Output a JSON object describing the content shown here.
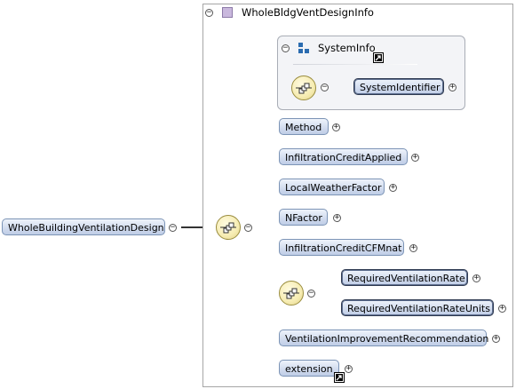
{
  "outer_type": {
    "title": "WholeBldgVentDesignInfo",
    "toggle": "−"
  },
  "system_info": {
    "title": "SystemInfo",
    "toggle": "−"
  },
  "root": {
    "label": "WholeBuildingVentilationDesign",
    "toggle": "−"
  },
  "system_identifier": {
    "label": "SystemIdentifier",
    "toggle": "+"
  },
  "elements": [
    {
      "label": "Method",
      "toggle": "+"
    },
    {
      "label": "InfiltrationCreditApplied",
      "toggle": "+"
    },
    {
      "label": "LocalWeatherFactor",
      "toggle": "+"
    },
    {
      "label": "NFactor",
      "toggle": "+"
    },
    {
      "label": "InfiltrationCreditCFMnat",
      "toggle": "+"
    }
  ],
  "choice_children": [
    {
      "label": "RequiredVentilationRate",
      "toggle": "+"
    },
    {
      "label": "RequiredVentilationRateUnits",
      "toggle": "+"
    }
  ],
  "tail_elements": [
    {
      "label": "VentilationImprovementRecommendation",
      "toggle": "+"
    },
    {
      "label": "extension",
      "toggle": "+"
    }
  ],
  "colors": {
    "node_fill_top": "#eef3fb",
    "node_fill_bottom": "#bfcde6",
    "node_border": "#7c94b6",
    "required_border": "#303b52",
    "compositor_fill": "#f6ecb2",
    "connector_line": "#333333",
    "optional_line": "#bfbfbf",
    "type_icon": "#c9b8dd",
    "systeminfo_icon": "#2b6cb0"
  }
}
